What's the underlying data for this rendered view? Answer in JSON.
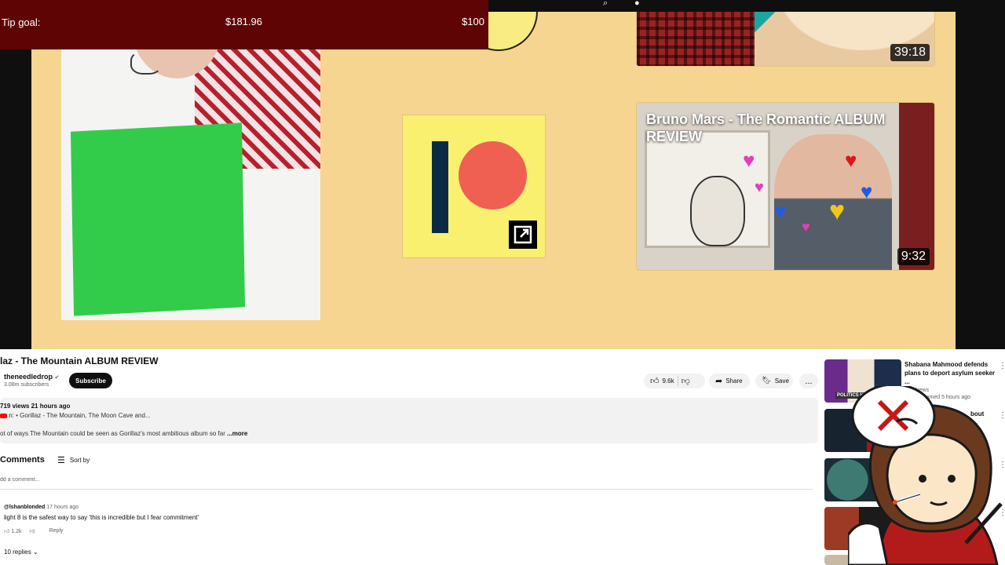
{
  "tip_goal": {
    "label": "Tip goal:",
    "current": "$181.96",
    "goal": "$100"
  },
  "endscreen": {
    "top_video": {
      "duration": "39:18"
    },
    "bruno": {
      "title": "Bruno Mars - The Romantic ALBUM REVIEW",
      "duration": "9:32"
    }
  },
  "video": {
    "title": "laz - The Mountain ALBUM REVIEW",
    "channel": "theneedledrop",
    "subscribers": "3.08m subscribers",
    "subscribe_label": "Subscribe",
    "likes": "9.6k",
    "share_label": "Share",
    "save_label": "Save",
    "more_label": "..."
  },
  "description": {
    "stats": "719 views  21 hours ago",
    "playlist": "n:  • Gorillaz - The Mountain, The Moon Cave and...",
    "text": "ot of ways The Mountain could be seen as Gorillaz's most ambitious album so far",
    "more": "...more"
  },
  "comments": {
    "heading": "Comments",
    "sort_label": "Sort by",
    "add_placeholder": "dd a comment...",
    "items": [
      {
        "user": "@lshanblonded",
        "time": "17 hours ago",
        "text": "light 8 is the safest way to say 'this is incredible but I fear commitment'",
        "likes": "1.2k",
        "reply_label": "Reply",
        "replies_label": "10 replies"
      }
    ]
  },
  "sidebar": {
    "items": [
      {
        "title": "Shabana Mahmood defends plans to deport asylum seeker ...",
        "meta": "Sky News",
        "meta2": "ws · Streamed 5 hours ago",
        "thumb_label": "POLITICS HUB"
      },
      {
        "title": "bout",
        "meta": "| ...",
        "meta2": "here."
      },
      {
        "title": "",
        "meta": ""
      },
      {
        "title": "",
        "meta": ""
      },
      {
        "title": "w",
        "meta": ""
      }
    ]
  },
  "colors": {
    "tip_bar": "#5e0404",
    "endscreen_bg": "#f6d590",
    "patreon_bg": "#f9f06f",
    "patreon_dot": "#ef6052",
    "patreon_bar": "#0b2b45"
  }
}
